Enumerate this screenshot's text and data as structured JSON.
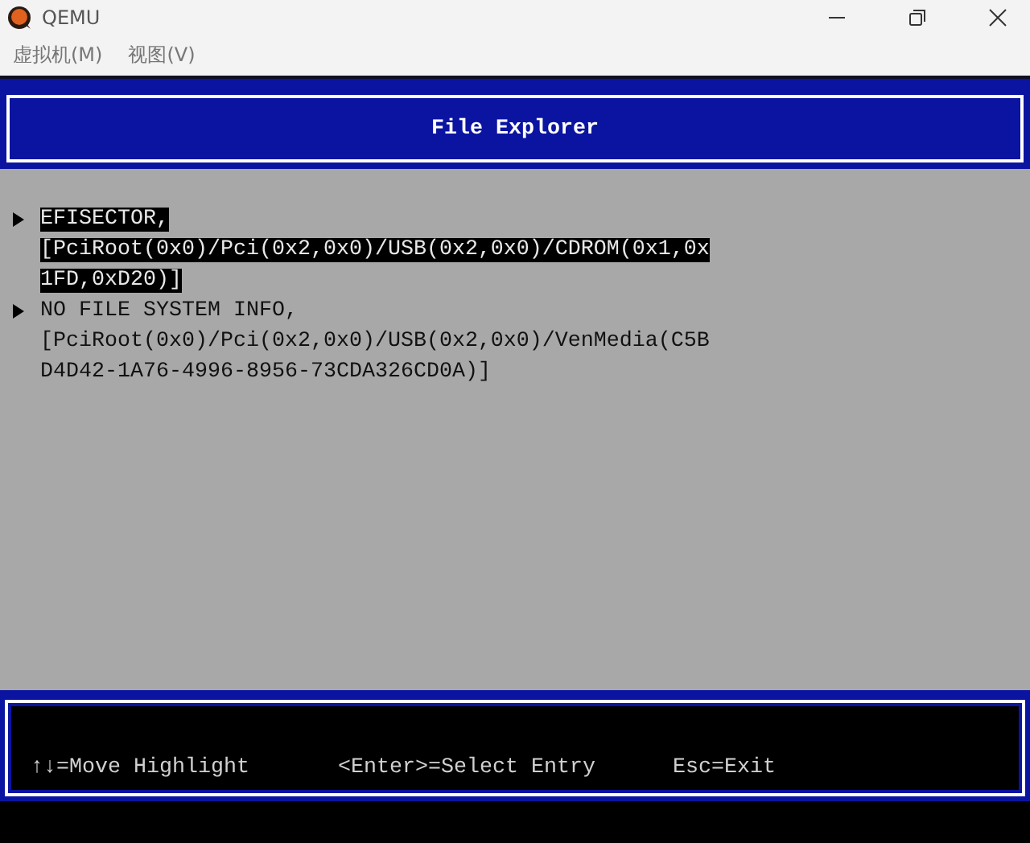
{
  "window": {
    "title": "QEMU"
  },
  "menu": [
    "虚拟机(M)",
    "视图(V)"
  ],
  "header": {
    "title": "File Explorer"
  },
  "entries": [
    {
      "selected": true,
      "lines": [
        "EFISECTOR,",
        "[PciRoot(0x0)/Pci(0x2,0x0)/USB(0x2,0x0)/CDROM(0x1,0x",
        "1FD,0xD20)]"
      ]
    },
    {
      "selected": false,
      "lines": [
        "NO FILE SYSTEM INFO,",
        "[PciRoot(0x0)/Pci(0x2,0x0)/USB(0x2,0x0)/VenMedia(C5B",
        "D4D42-1A76-4996-8956-73CDA326CD0A)]"
      ]
    }
  ],
  "footer": [
    "↑↓=Move Highlight",
    "<Enter>=Select Entry",
    "Esc=Exit"
  ]
}
